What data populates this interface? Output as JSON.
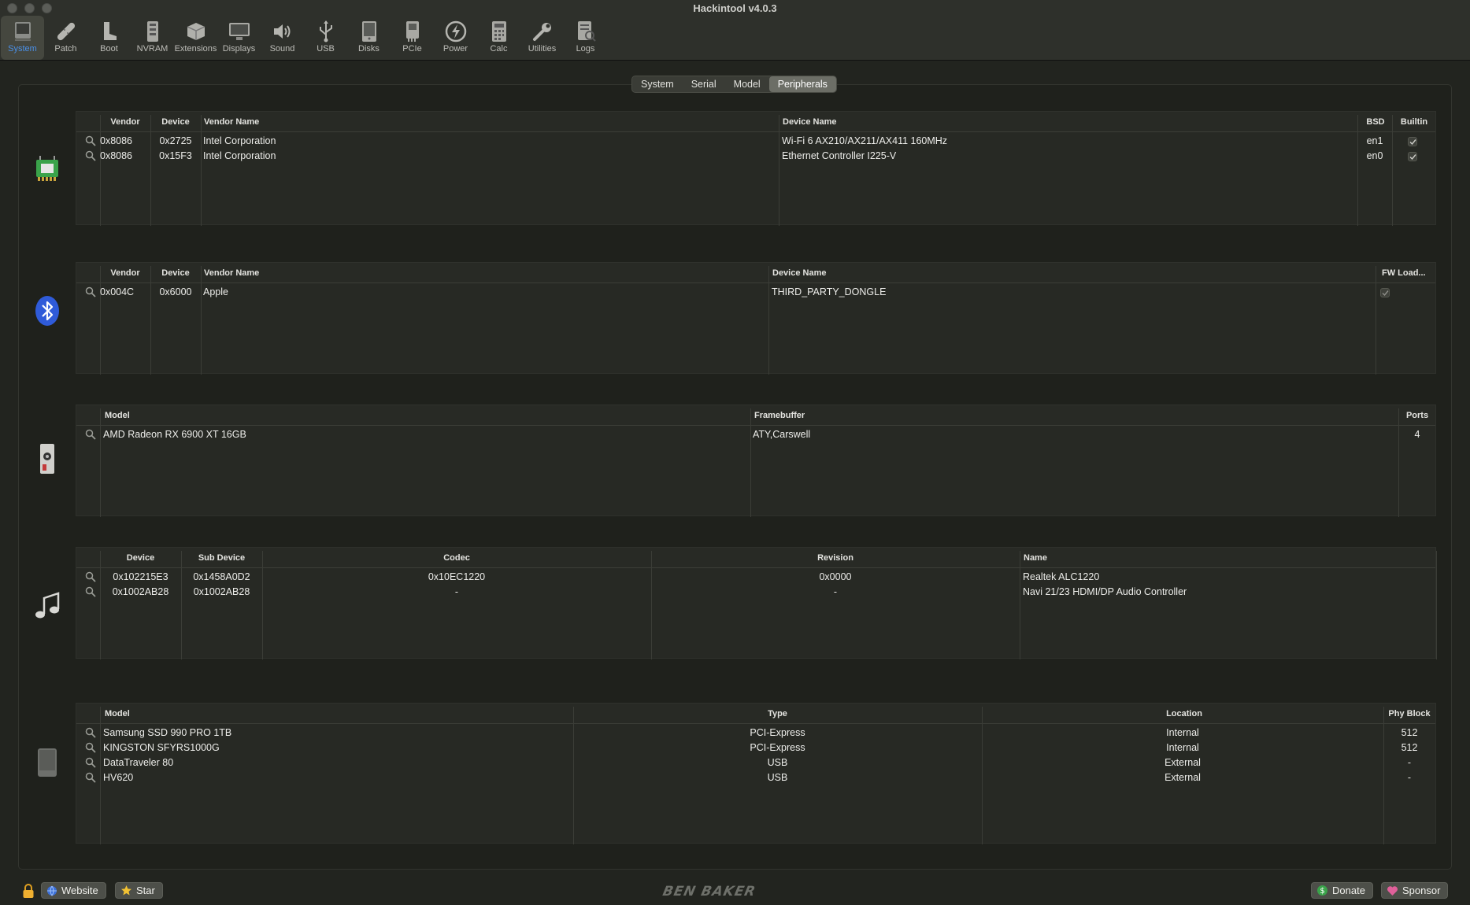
{
  "window": {
    "title": "Hackintool v4.0.3"
  },
  "toolbar": [
    {
      "label": "System",
      "icon": "system-icon",
      "active": true
    },
    {
      "label": "Patch",
      "icon": "patch-icon"
    },
    {
      "label": "Boot",
      "icon": "boot-icon"
    },
    {
      "label": "NVRAM",
      "icon": "nvram-icon"
    },
    {
      "label": "Extensions",
      "icon": "extensions-icon"
    },
    {
      "label": "Displays",
      "icon": "displays-icon"
    },
    {
      "label": "Sound",
      "icon": "sound-icon"
    },
    {
      "label": "USB",
      "icon": "usb-icon"
    },
    {
      "label": "Disks",
      "icon": "disks-icon"
    },
    {
      "label": "PCIe",
      "icon": "pcie-icon"
    },
    {
      "label": "Power",
      "icon": "power-icon"
    },
    {
      "label": "Calc",
      "icon": "calc-icon"
    },
    {
      "label": "Utilities",
      "icon": "utilities-icon"
    },
    {
      "label": "Logs",
      "icon": "logs-icon"
    }
  ],
  "tabs": [
    {
      "label": "System"
    },
    {
      "label": "Serial"
    },
    {
      "label": "Model"
    },
    {
      "label": "Peripherals",
      "active": true
    }
  ],
  "network": {
    "headers": {
      "vendor": "Vendor",
      "device": "Device",
      "vendor_name": "Vendor Name",
      "device_name": "Device Name",
      "bsd": "BSD",
      "builtin": "Builtin"
    },
    "rows": [
      {
        "vendor": "0x8086",
        "device": "0x2725",
        "vendor_name": "Intel Corporation",
        "device_name": "Wi-Fi 6 AX210/AX211/AX411 160MHz",
        "bsd": "en1",
        "builtin": true
      },
      {
        "vendor": "0x8086",
        "device": "0x15F3",
        "vendor_name": "Intel Corporation",
        "device_name": "Ethernet Controller I225-V",
        "bsd": "en0",
        "builtin": true
      }
    ]
  },
  "bluetooth": {
    "headers": {
      "vendor": "Vendor",
      "device": "Device",
      "vendor_name": "Vendor Name",
      "device_name": "Device Name",
      "fw_loaded": "FW Load..."
    },
    "rows": [
      {
        "vendor": "0x004C",
        "device": "0x6000",
        "vendor_name": "Apple",
        "device_name": "THIRD_PARTY_DONGLE",
        "fw_loaded": true
      }
    ]
  },
  "graphics": {
    "headers": {
      "model": "Model",
      "framebuffer": "Framebuffer",
      "ports": "Ports"
    },
    "rows": [
      {
        "model": "AMD Radeon RX 6900 XT 16GB",
        "framebuffer": "ATY,Carswell",
        "ports": "4"
      }
    ]
  },
  "audio": {
    "headers": {
      "device": "Device",
      "sub_device": "Sub Device",
      "codec": "Codec",
      "revision": "Revision",
      "name": "Name"
    },
    "rows": [
      {
        "device": "0x102215E3",
        "sub_device": "0x1458A0D2",
        "codec": "0x10EC1220",
        "revision": "0x0000",
        "name": "Realtek ALC1220"
      },
      {
        "device": "0x1002AB28",
        "sub_device": "0x1002AB28",
        "codec": "-",
        "revision": "-",
        "name": "Navi 21/23 HDMI/DP Audio Controller"
      }
    ]
  },
  "storage": {
    "headers": {
      "model": "Model",
      "type": "Type",
      "location": "Location",
      "phy_block": "Phy Block"
    },
    "rows": [
      {
        "model": "Samsung SSD 990 PRO 1TB",
        "type": "PCI-Express",
        "location": "Internal",
        "phy_block": "512"
      },
      {
        "model": "KINGSTON SFYRS1000G",
        "type": "PCI-Express",
        "location": "Internal",
        "phy_block": "512"
      },
      {
        "model": "DataTraveler 80",
        "type": "USB",
        "location": "External",
        "phy_block": "-"
      },
      {
        "model": "HV620",
        "type": "USB",
        "location": "External",
        "phy_block": "-"
      }
    ]
  },
  "bottom": {
    "website_label": "Website",
    "star_label": "Star",
    "signature": "BEN BAKER",
    "donate_label": "Donate",
    "sponsor_label": "Sponsor"
  },
  "colors": {
    "accent": "#4a90e8",
    "background": "#22241f",
    "table": "#272924",
    "bluetooth": "#2f5bd9"
  }
}
